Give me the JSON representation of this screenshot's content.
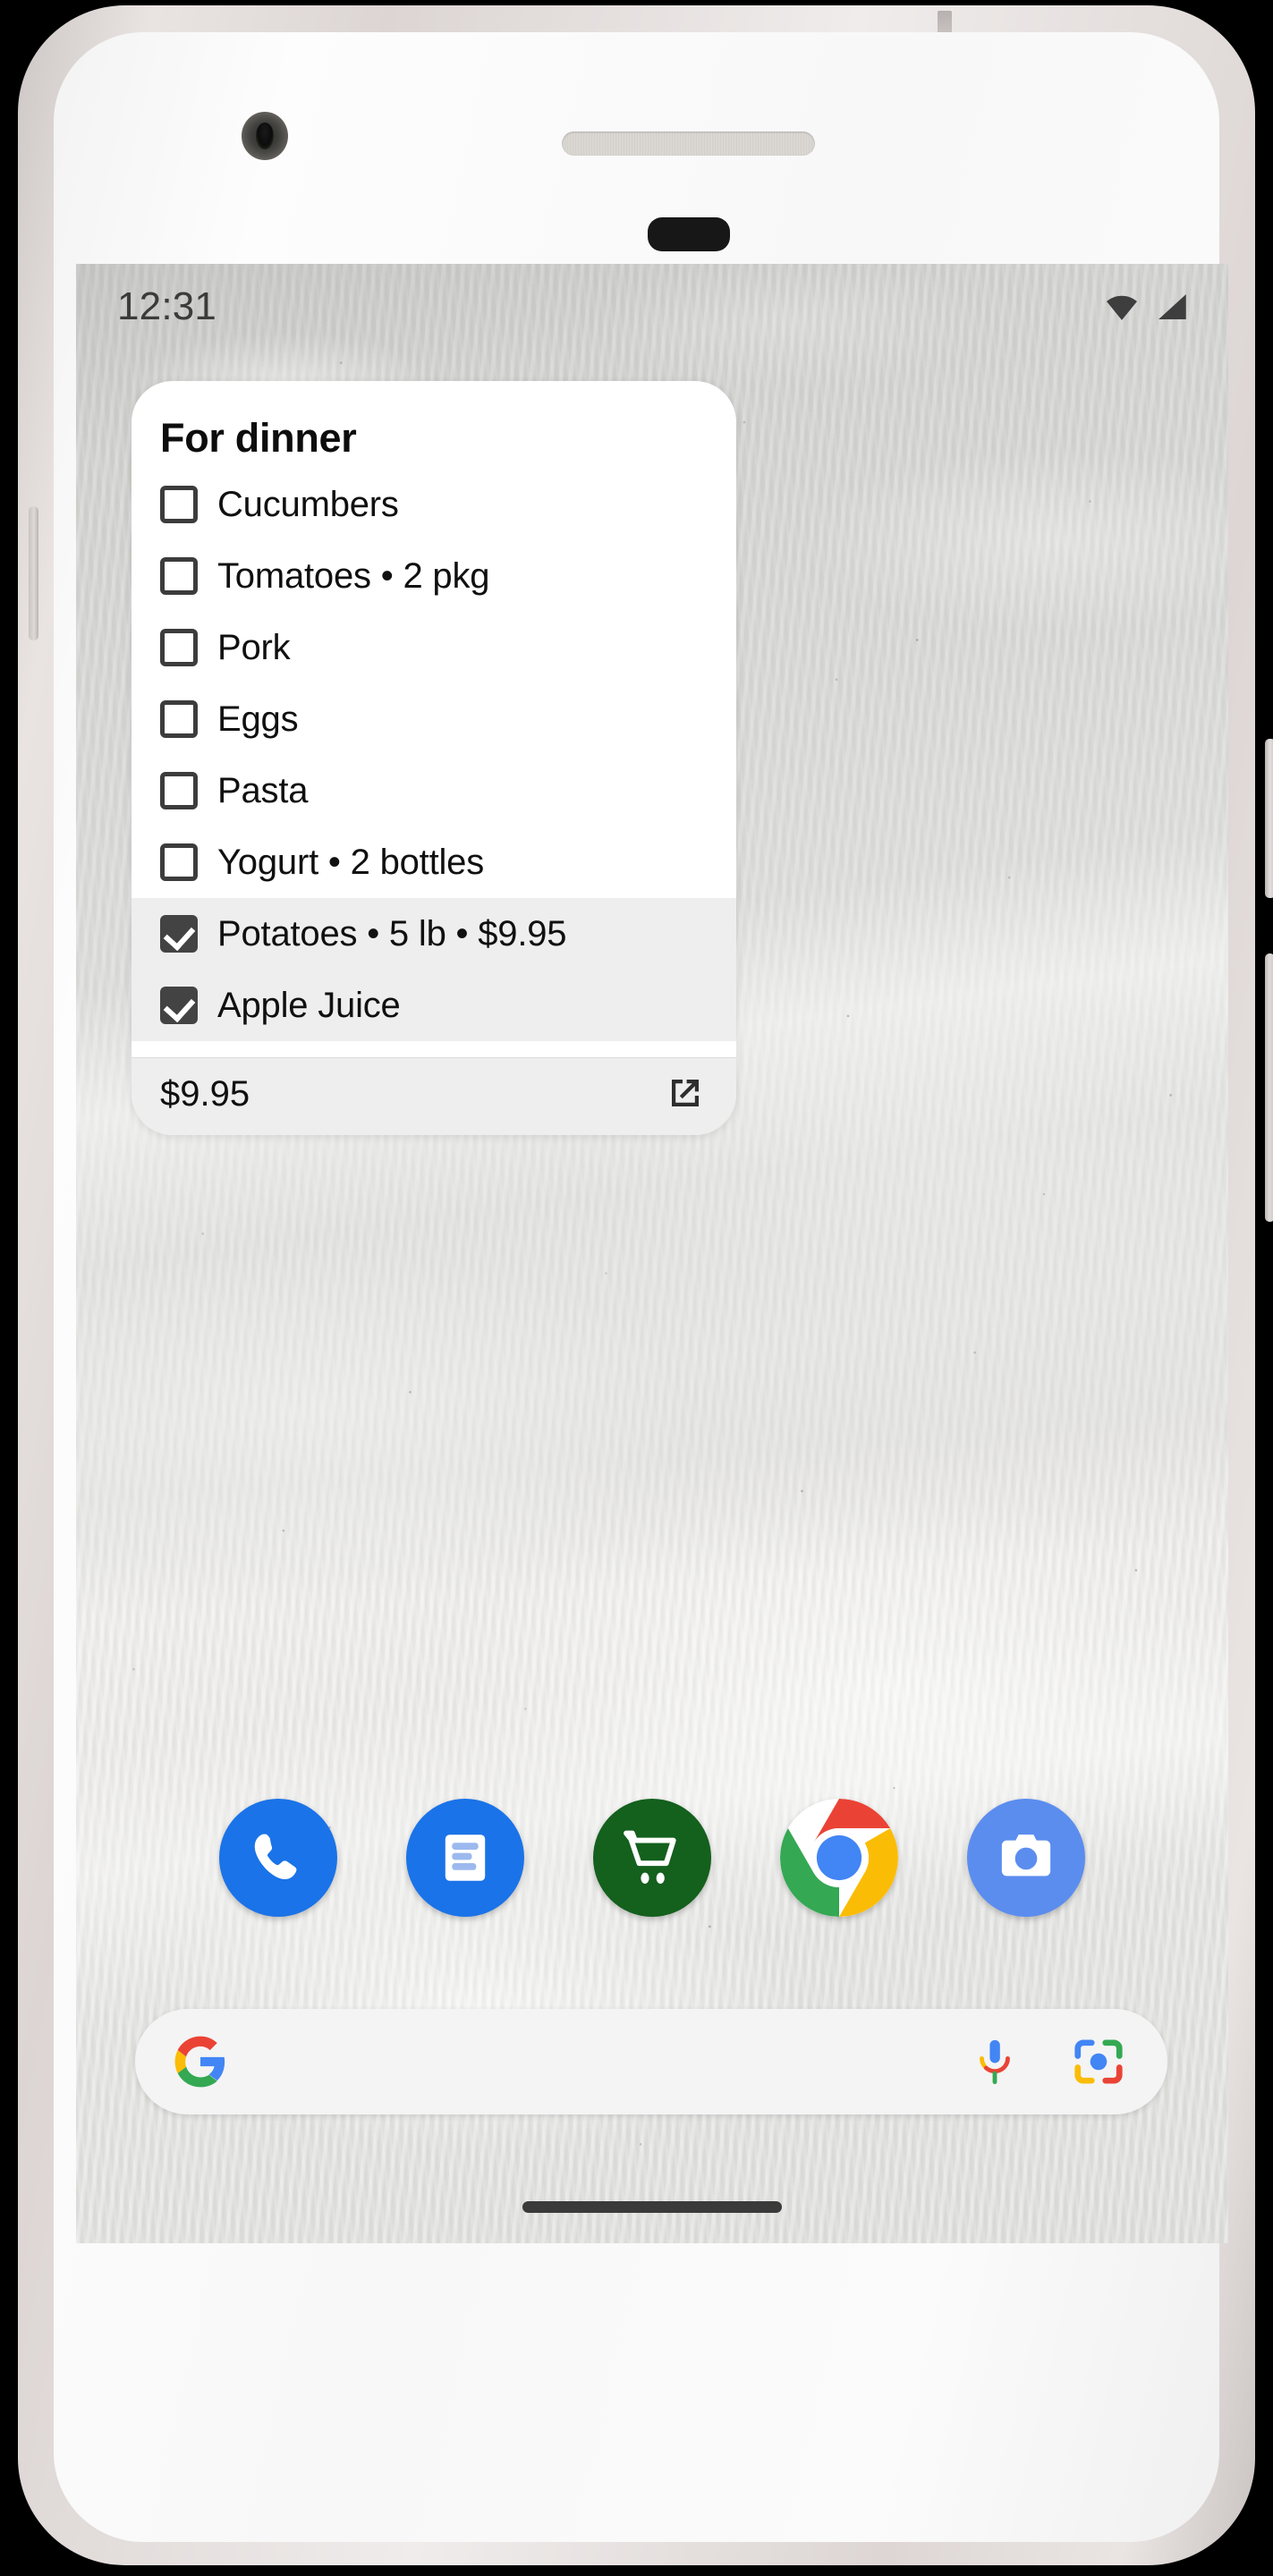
{
  "status_bar": {
    "clock": "12:31",
    "icons": [
      "wifi-icon",
      "cellular-signal-icon"
    ]
  },
  "widget": {
    "title": "For dinner",
    "items": [
      {
        "label": "Cucumbers",
        "checked": false
      },
      {
        "label": "Tomatoes • 2 pkg",
        "checked": false
      },
      {
        "label": "Pork",
        "checked": false
      },
      {
        "label": "Eggs",
        "checked": false
      },
      {
        "label": "Pasta",
        "checked": false
      },
      {
        "label": "Yogurt • 2 bottles",
        "checked": false
      },
      {
        "label": "Potatoes • 5 lb • $9.95",
        "checked": true
      },
      {
        "label": "Apple Juice",
        "checked": true
      }
    ],
    "footer": {
      "total": "$9.95",
      "open_icon": "open-in-new-icon"
    }
  },
  "dock": {
    "apps": [
      {
        "name": "phone-app",
        "icon": "phone-icon"
      },
      {
        "name": "messages-app",
        "icon": "messages-icon"
      },
      {
        "name": "shopping-app",
        "icon": "shopping-cart-icon"
      },
      {
        "name": "chrome-app",
        "icon": "chrome-icon"
      },
      {
        "name": "camera-app",
        "icon": "camera-icon"
      }
    ]
  },
  "search": {
    "placeholder": "",
    "value": "",
    "logo_icon": "google-g-icon",
    "mic_icon": "microphone-icon",
    "lens_icon": "google-lens-icon"
  },
  "colors": {
    "accent_blue": "#1a73e8",
    "cart_green": "#14601d",
    "checkbox_dark": "#434343",
    "widget_bg": "#ffffff",
    "checked_row_bg": "#eeeeee"
  }
}
